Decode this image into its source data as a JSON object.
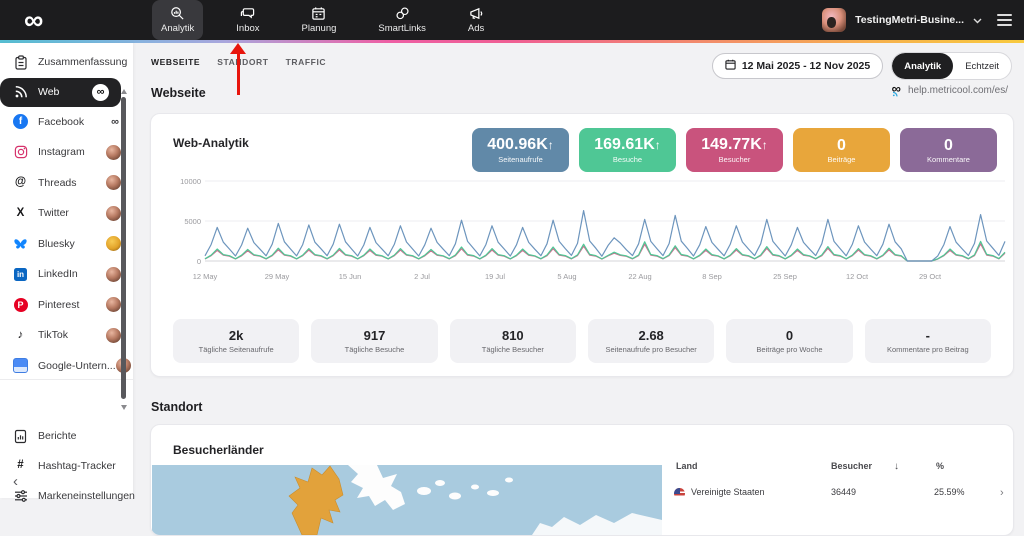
{
  "topbar": {
    "logo_icon": "∞",
    "nav": [
      {
        "label": "Analytik",
        "icon": "magnifier-chart-icon",
        "active": true
      },
      {
        "label": "Inbox",
        "icon": "chat-bubbles-icon",
        "active": false
      },
      {
        "label": "Planung",
        "icon": "calendar-icon",
        "active": false
      },
      {
        "label": "SmartLinks",
        "icon": "links-icon",
        "active": false
      },
      {
        "label": "Ads",
        "icon": "megaphone-icon",
        "active": false
      }
    ],
    "account": {
      "name": "TestingMetri-Busine..."
    }
  },
  "annotation": {
    "type": "red-arrow",
    "points_to": "Inbox"
  },
  "sidebar": {
    "channels": [
      {
        "label": "Zusammenfassung"
      },
      {
        "label": "Web",
        "active": true,
        "badge": "∞"
      },
      {
        "label": "Facebook",
        "badge": "∞"
      },
      {
        "label": "Instagram",
        "badge": "avatar"
      },
      {
        "label": "Threads",
        "badge": "avatar"
      },
      {
        "label": "Twitter",
        "badge": "avatar"
      },
      {
        "label": "Bluesky",
        "badge": "avatar"
      },
      {
        "label": "LinkedIn",
        "badge": "avatar"
      },
      {
        "label": "Pinterest",
        "badge": "avatar"
      },
      {
        "label": "TikTok",
        "badge": "avatar"
      },
      {
        "label": "Google-Untern...",
        "badge": "avatar"
      }
    ],
    "tools": [
      {
        "label": "Berichte"
      },
      {
        "label": "Hashtag-Tracker"
      },
      {
        "label": "Markeneinstellungen"
      }
    ],
    "glyphs": {
      "infinity": "∞",
      "facebook": "f",
      "threads": "@",
      "twitter": "X",
      "linkedin": "in",
      "pinterest": "P",
      "tiktok": "♪",
      "hashtag": "#",
      "collapse": "‹"
    }
  },
  "subnav": {
    "tabs": [
      {
        "label": "WEBSEITE",
        "active": true
      },
      {
        "label": "STANDORT",
        "active": false
      },
      {
        "label": "TRAFFIC",
        "active": false
      }
    ],
    "date_range": "12 Mai 2025 - 12 Nov 2025",
    "modes": [
      {
        "label": "Analytik",
        "active": true
      },
      {
        "label": "Echtzeit",
        "active": false
      }
    ]
  },
  "page": {
    "section_webseite": "Webseite",
    "help_link": "help.metricool.com/es/",
    "section_standort": "Standort"
  },
  "web_analytics": {
    "title": "Web-Analytik",
    "kpis": [
      {
        "value": "400.96K",
        "trend": "↑",
        "label": "Seitenaufrufe",
        "color": "#6189a8"
      },
      {
        "value": "169.61K",
        "trend": "↑",
        "label": "Besuche",
        "color": "#4fc795"
      },
      {
        "value": "149.77K",
        "trend": "↑",
        "label": "Besucher",
        "color": "#c9537d"
      },
      {
        "value": "0",
        "trend": "",
        "label": "Beiträge",
        "color": "#e8a63b"
      },
      {
        "value": "0",
        "trend": "",
        "label": "Kommentare",
        "color": "#8b6a98"
      }
    ],
    "summary": [
      {
        "value": "2k",
        "label": "Tägliche Seitenaufrufe"
      },
      {
        "value": "917",
        "label": "Tägliche Besuche"
      },
      {
        "value": "810",
        "label": "Tägliche Besucher"
      },
      {
        "value": "2.68",
        "label": "Seitenaufrufe pro Besucher"
      },
      {
        "value": "0",
        "label": "Beiträge pro Woche"
      },
      {
        "value": "-",
        "label": "Kommentare pro Beitrag"
      }
    ]
  },
  "chart_data": {
    "type": "line",
    "title": "Web-Analytik",
    "x_labels": [
      "12 May",
      "29 May",
      "15 Jun",
      "2 Jul",
      "19 Jul",
      "5 Aug",
      "22 Aug",
      "8 Sep",
      "25 Sep",
      "12 Oct",
      "29 Oct"
    ],
    "y_ticks": [
      "10000",
      "5000",
      "0"
    ],
    "ylim": [
      0,
      10000
    ],
    "grid": true,
    "legend": "none",
    "note": "daily values 12 May - 12 Nov, weekly spike pattern, zero-gap mid October",
    "series": [
      {
        "name": "Seitenaufrufe",
        "color": "#6d95bd",
        "values": [
          650,
          2050,
          4200,
          2350,
          1500,
          620,
          2000,
          4100,
          2300,
          1480,
          650,
          2100,
          4700,
          2400,
          1500,
          640,
          2050,
          4500,
          2350,
          1520,
          660,
          2100,
          4600,
          2400,
          1500,
          630,
          2000,
          4200,
          2300,
          1480,
          650,
          2080,
          4400,
          2380,
          1500,
          620,
          2020,
          4100,
          2320,
          1470,
          660,
          2150,
          5100,
          2450,
          1550,
          640,
          2050,
          4400,
          2350,
          1500,
          630,
          2030,
          4200,
          2330,
          1480,
          660,
          2150,
          5100,
          2450,
          1550,
          700,
          2200,
          6300,
          2500,
          1600,
          600,
          1950,
          2900,
          2250,
          1400,
          670,
          2150,
          5200,
          2450,
          1550,
          680,
          2180,
          5700,
          2480,
          1580,
          630,
          2030,
          4300,
          2330,
          1480,
          650,
          2080,
          4400,
          2380,
          1500,
          670,
          2150,
          5200,
          2450,
          1550,
          630,
          2020,
          4200,
          2320,
          1470,
          670,
          2150,
          5200,
          2450,
          1550,
          650,
          2080,
          4400,
          2380,
          1500,
          660,
          2100,
          4600,
          2400,
          1520,
          0,
          0,
          0,
          0,
          0,
          640,
          2050,
          4300,
          2350,
          1500,
          690,
          2200,
          5800,
          2500,
          1600,
          700,
          2450
        ]
      },
      {
        "name": "Besuche",
        "color": "#4fc795",
        "values": [
          280,
          730,
          1500,
          800,
          660,
          270,
          720,
          1450,
          790,
          650,
          285,
          740,
          1600,
          805,
          665,
          280,
          730,
          1550,
          800,
          660,
          285,
          740,
          1580,
          805,
          665,
          275,
          725,
          1500,
          795,
          655,
          280,
          735,
          1550,
          800,
          660,
          270,
          720,
          1450,
          790,
          650,
          290,
          750,
          1750,
          810,
          670,
          280,
          730,
          1550,
          800,
          660,
          275,
          725,
          1500,
          795,
          655,
          290,
          750,
          1750,
          810,
          670,
          300,
          760,
          2100,
          820,
          680,
          260,
          700,
          1100,
          770,
          640,
          295,
          755,
          2400,
          815,
          675,
          295,
          755,
          1900,
          815,
          675,
          275,
          725,
          1500,
          795,
          655,
          280,
          735,
          1550,
          800,
          660,
          290,
          750,
          1800,
          810,
          670,
          275,
          725,
          1500,
          795,
          655,
          290,
          750,
          1800,
          810,
          670,
          280,
          735,
          1550,
          800,
          660,
          285,
          740,
          1600,
          805,
          665,
          0,
          0,
          0,
          0,
          0,
          280,
          730,
          1500,
          800,
          660,
          300,
          760,
          2450,
          820,
          680,
          300,
          1100
        ]
      },
      {
        "name": "Besucher",
        "color": "#cf6d8f",
        "values": [
          250,
          660,
          1320,
          720,
          600,
          245,
          655,
          1280,
          715,
          595,
          255,
          665,
          1400,
          725,
          605,
          250,
          660,
          1360,
          720,
          600,
          255,
          665,
          1390,
          725,
          605,
          248,
          658,
          1320,
          718,
          598,
          252,
          662,
          1360,
          722,
          602,
          245,
          655,
          1280,
          715,
          595,
          258,
          668,
          1540,
          728,
          608,
          250,
          660,
          1360,
          720,
          600,
          248,
          658,
          1320,
          718,
          598,
          258,
          668,
          1540,
          728,
          608,
          265,
          675,
          1850,
          735,
          615,
          240,
          645,
          970,
          705,
          585,
          262,
          672,
          2100,
          732,
          612,
          262,
          672,
          1670,
          732,
          612,
          248,
          658,
          1320,
          718,
          598,
          252,
          662,
          1360,
          722,
          602,
          258,
          668,
          1580,
          728,
          608,
          248,
          658,
          1320,
          718,
          598,
          258,
          668,
          1580,
          728,
          608,
          252,
          662,
          1360,
          722,
          602,
          255,
          665,
          1400,
          725,
          605,
          0,
          0,
          0,
          0,
          0,
          250,
          660,
          1320,
          720,
          600,
          262,
          672,
          2150,
          732,
          612,
          270,
          980
        ]
      }
    ]
  },
  "standort_card": {
    "title": "Besucherländer",
    "map_colors": {
      "ocean": "#a9cbdf",
      "highlight": "#e2a23b",
      "land": "#fdfdfd"
    },
    "table": {
      "headers": [
        "Land",
        "Besucher",
        "%"
      ],
      "sort_icon": "↓",
      "rows": [
        {
          "land": "Vereinigte Staaten",
          "besucher": "36449",
          "pct": "25.59%",
          "chevron": "›"
        }
      ]
    }
  }
}
